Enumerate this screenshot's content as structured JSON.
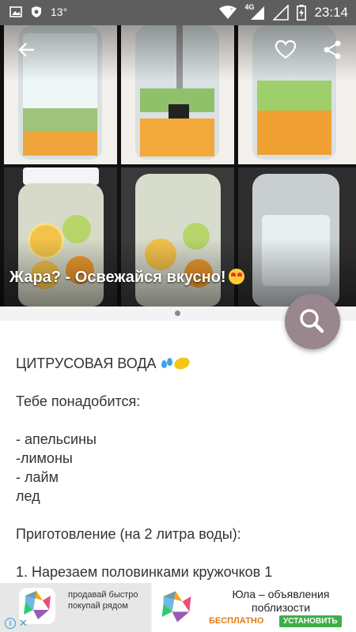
{
  "status_bar": {
    "temperature": "13°",
    "network": "4G",
    "time": "23:14"
  },
  "hero": {
    "caption": "Жара? - Освежайся вкусно!"
  },
  "content": {
    "title": "ЦИТРУСОВАЯ ВОДА",
    "need_heading": "Тебе понадобится:",
    "ingredients": [
      "- апельсины",
      "-лимоны",
      "- лайм",
      "лед"
    ],
    "prep_heading": "Приготовление (на 2 литра воды):",
    "step_1": "1. Нарезаем половинками кружочков 1"
  },
  "ad": {
    "left_text_1": "продавай быстро",
    "left_text_2": "покупай рядом",
    "title_line_1": "Юла – объявления",
    "title_line_2": "поблизости",
    "free_label": "БЕСПЛАТНО",
    "install_label": "УСТАНОВИТЬ",
    "info_label": "i",
    "close_label": "✕"
  }
}
